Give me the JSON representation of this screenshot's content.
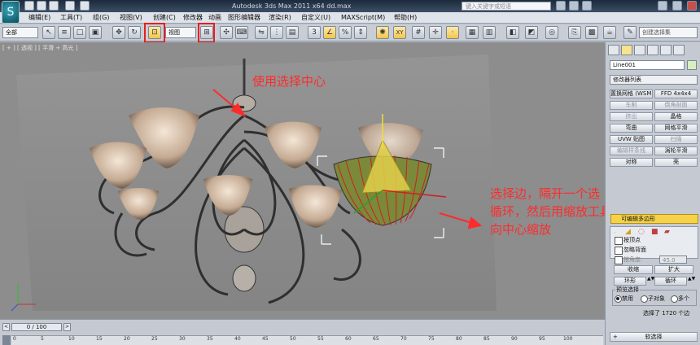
{
  "title_bar": {
    "title": "Autodesk 3ds Max  2011 x64       dd.max",
    "search_placeholder": "键入关键字或短语"
  },
  "menu": [
    "编辑(E)",
    "工具(T)",
    "组(G)",
    "视图(V)",
    "创建(C)",
    "修改器",
    "动画",
    "图形编辑器",
    "渲染(R)",
    "自定义(U)",
    "MAXScript(M)",
    "帮助(H)"
  ],
  "toolbar": {
    "selection_filter": "全部",
    "coord_system": "视图",
    "named_selection": "创建选择集",
    "snap_label": "3",
    "axis_constraint": "XY"
  },
  "viewport": {
    "label": "[ + ] [ 透视 ] [ 平滑 + 高光 ]"
  },
  "annotations": {
    "use_selection_center": "使用选择中心",
    "select_edges_note": [
      "选择边，隔开一个选",
      "循环，然后用缩放工具",
      "向中心缩放"
    ]
  },
  "command_panel": {
    "object_name": "Line001",
    "modifier_list": "修改器列表",
    "buttons": [
      {
        "label": "置换网格 (WSM)",
        "enabled": true
      },
      {
        "label": "FFD 4x4x4",
        "enabled": true
      },
      {
        "label": "车削",
        "enabled": false
      },
      {
        "label": "倒角剖面",
        "enabled": false
      },
      {
        "label": "挤出",
        "enabled": false
      },
      {
        "label": "晶格",
        "enabled": true
      },
      {
        "label": "弯曲",
        "enabled": true
      },
      {
        "label": "网格平滑",
        "enabled": true
      },
      {
        "label": "UVW 贴图",
        "enabled": true
      },
      {
        "label": "扫描",
        "enabled": false
      },
      {
        "label": "编辑样条线",
        "enabled": false
      },
      {
        "label": "涡轮平滑",
        "enabled": true
      },
      {
        "label": "对称",
        "enabled": true
      },
      {
        "label": "壳",
        "enabled": true
      }
    ],
    "stack_item": "可编辑多边形",
    "selection": {
      "by_vertex": "按顶点",
      "ignore_backfacing": "忽略背面",
      "by_angle": "按角度:",
      "angle_value": "45.0",
      "shrink": "收缩",
      "grow": "扩大",
      "ring": "环形",
      "loop": "循环",
      "preview_title": "预览选择",
      "preview_disabled": "禁用",
      "preview_subobject": "子对象",
      "preview_multi": "多个",
      "status": "选择了 1720 个边",
      "soft_selection": "软选择"
    }
  },
  "timeline": {
    "frame_display": "0 / 100",
    "ticks": [
      "0",
      "5",
      "10",
      "15",
      "20",
      "25",
      "30",
      "35",
      "40",
      "45",
      "50",
      "55",
      "60",
      "65",
      "70",
      "75",
      "80",
      "85",
      "90",
      "95",
      "100"
    ]
  },
  "colors": {
    "annotation_red": "#ff2b2b",
    "stack_yellow": "#f5d24a",
    "viewport_bg": "#8d8d8d"
  }
}
